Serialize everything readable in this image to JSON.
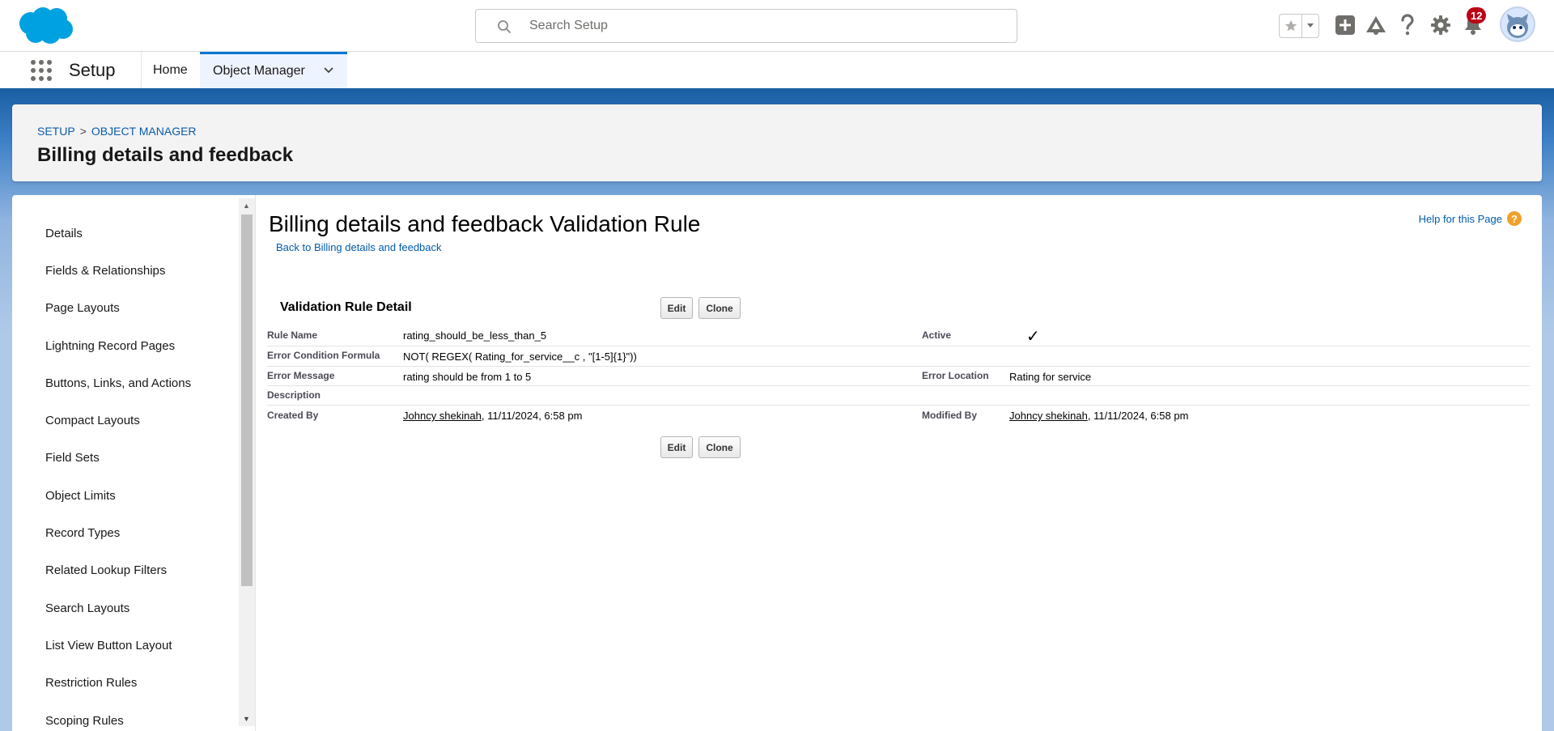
{
  "header": {
    "search_placeholder": "Search Setup",
    "notification_count": "12",
    "icons": [
      "favorites-star-icon",
      "favorites-dropdown-icon",
      "global-actions-icon",
      "trailhead-icon",
      "help-icon",
      "setup-gear-icon",
      "notifications-bell-icon",
      "user-avatar"
    ]
  },
  "context_bar": {
    "app_name": "Setup",
    "tabs": [
      {
        "label": "Home"
      },
      {
        "label": "Object Manager"
      }
    ]
  },
  "page_header": {
    "breadcrumb": [
      "SETUP",
      "OBJECT MANAGER"
    ],
    "separator": ">",
    "title": "Billing details and feedback"
  },
  "sidenav": {
    "items": [
      "Details",
      "Fields & Relationships",
      "Page Layouts",
      "Lightning Record Pages",
      "Buttons, Links, and Actions",
      "Compact Layouts",
      "Field Sets",
      "Object Limits",
      "Record Types",
      "Related Lookup Filters",
      "Search Layouts",
      "List View Button Layout",
      "Restriction Rules",
      "Scoping Rules"
    ]
  },
  "content": {
    "title": "Billing details and feedback Validation Rule",
    "back_link": "Back to Billing details and feedback",
    "help_link": "Help for this Page",
    "help_glyph": "?",
    "section_title": "Validation Rule Detail",
    "edit_label": "Edit",
    "clone_label": "Clone",
    "fields": {
      "rule_name_label": "Rule Name",
      "rule_name_value": "rating_should_be_less_than_5",
      "active_label": "Active",
      "active_check": "✓",
      "formula_label": "Error Condition Formula",
      "formula_value": "NOT( REGEX( Rating_for_service__c , \"[1-5]{1}\"))",
      "message_label": "Error Message",
      "message_value": "rating should be from 1 to 5",
      "location_label": "Error Location",
      "location_value": "Rating for service",
      "description_label": "Description",
      "description_value": "",
      "created_label": "Created By",
      "created_user": "Johncy shekinah",
      "created_date": ", 11/11/2024, 6:58 pm",
      "modified_label": "Modified By",
      "modified_user": "Johncy shekinah",
      "modified_date": ", 11/11/2024, 6:58 pm"
    }
  },
  "colors": {
    "brand_blue": "#0176d3",
    "link_blue": "#015ba7",
    "notification_red": "#ba0517",
    "help_orange": "#f0a12a"
  }
}
